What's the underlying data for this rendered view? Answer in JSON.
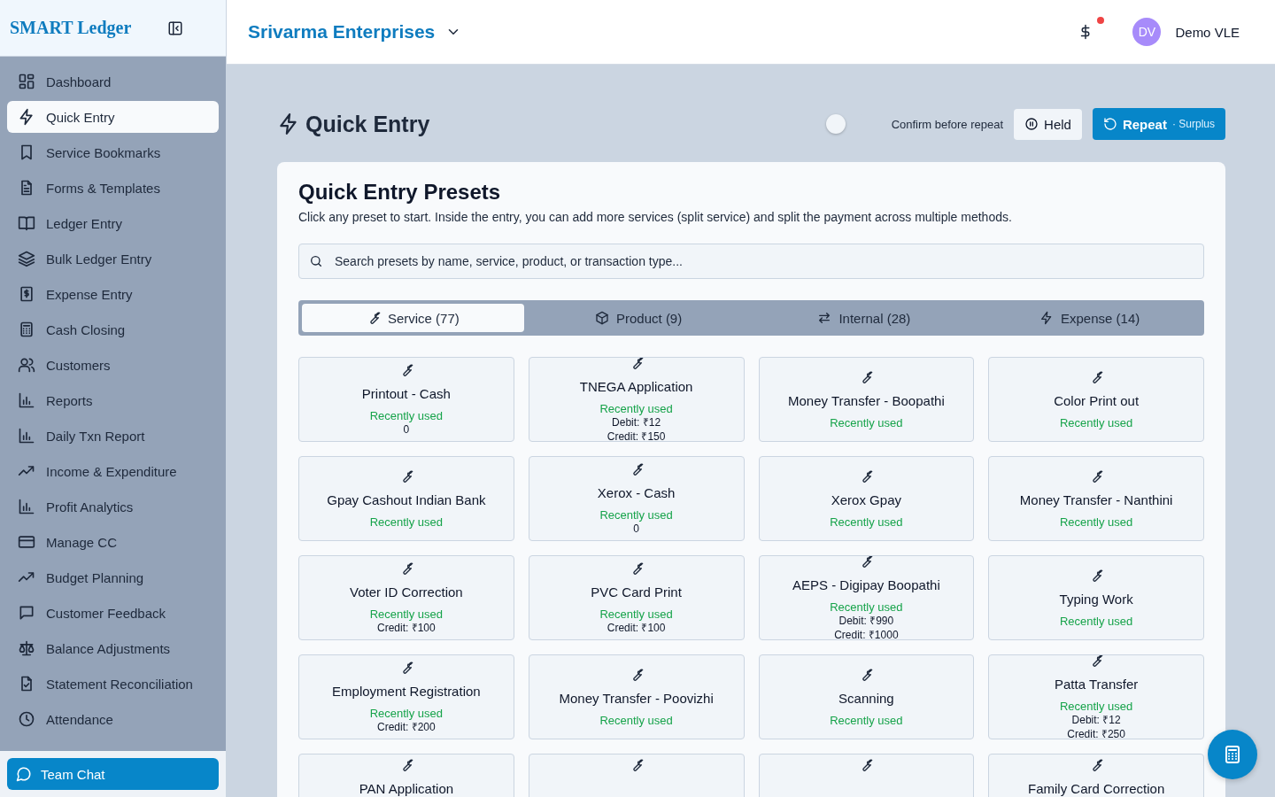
{
  "sidebar": {
    "logo": "SMART Ledger",
    "items": [
      {
        "label": "Dashboard",
        "selected": false
      },
      {
        "label": "Quick Entry",
        "selected": true
      },
      {
        "label": "Service Bookmarks",
        "selected": false
      },
      {
        "label": "Forms & Templates",
        "selected": false
      },
      {
        "label": "Ledger Entry",
        "selected": false
      },
      {
        "label": "Bulk Ledger Entry",
        "selected": false
      },
      {
        "label": "Expense Entry",
        "selected": false
      },
      {
        "label": "Cash Closing",
        "selected": false
      },
      {
        "label": "Customers",
        "selected": false
      },
      {
        "label": "Reports",
        "selected": false
      },
      {
        "label": "Daily Txn Report",
        "selected": false
      },
      {
        "label": "Income & Expenditure",
        "selected": false
      },
      {
        "label": "Profit Analytics",
        "selected": false
      },
      {
        "label": "Manage CC",
        "selected": false
      },
      {
        "label": "Budget Planning",
        "selected": false
      },
      {
        "label": "Customer Feedback",
        "selected": false
      },
      {
        "label": "Balance Adjustments",
        "selected": false
      },
      {
        "label": "Statement Reconciliation",
        "selected": false
      },
      {
        "label": "Attendance",
        "selected": false
      }
    ],
    "chat_button": "Team Chat"
  },
  "topbar": {
    "business": "Srivarma Enterprises",
    "notification": true,
    "avatar": "DV",
    "user": "Demo VLE"
  },
  "page": {
    "title": "Quick Entry",
    "confirm_toggle": {
      "label": "Confirm before repeat",
      "on": false
    },
    "held_button": "Held",
    "repeat_button": {
      "label": "Repeat",
      "note": "· Surplus"
    }
  },
  "presets": {
    "title": "Quick Entry Presets",
    "description": "Click any preset to start. Inside the entry, you can add more services (split service) and split the payment across multiple methods.",
    "search": {
      "placeholder": "Search presets by name, service, product, or transaction type..."
    },
    "tabs": [
      {
        "label": "Service (77)",
        "selected": true
      },
      {
        "label": "Product (9)",
        "selected": false
      },
      {
        "label": "Internal (28)",
        "selected": false
      },
      {
        "label": "Expense (14)",
        "selected": false
      }
    ],
    "cards": [
      {
        "title": "Printout - Cash",
        "badge": "Recently used",
        "details": [
          "0"
        ],
        "kind": "service"
      },
      {
        "title": "TNEGA Application",
        "badge": "Recently used",
        "details": [
          "Debit: ₹12",
          "Credit: ₹150"
        ],
        "kind": "service"
      },
      {
        "title": "Money Transfer - Boopathi",
        "badge": "Recently used",
        "kind": "service"
      },
      {
        "title": "Color Print out",
        "badge": "Recently used",
        "kind": "service"
      },
      {
        "title": "Gpay Cashout Indian Bank",
        "badge": "Recently used",
        "kind": "service"
      },
      {
        "title": "Xerox - Cash",
        "badge": "Recently used",
        "details": [
          "0"
        ],
        "kind": "service"
      },
      {
        "title": "Xerox Gpay",
        "badge": "Recently used",
        "kind": "service"
      },
      {
        "title": "Money Transfer - Nanthini",
        "badge": "Recently used",
        "kind": "service"
      },
      {
        "title": "Voter ID Correction",
        "badge": "Recently used",
        "details": [
          "Credit: ₹100"
        ],
        "kind": "service"
      },
      {
        "title": "PVC Card Print",
        "badge": "Recently used",
        "details": [
          "Credit: ₹100"
        ],
        "kind": "service"
      },
      {
        "title": "AEPS - Digipay Boopathi",
        "badge": "Recently used",
        "details": [
          "Debit: ₹990",
          "Credit: ₹1000"
        ],
        "kind": "service"
      },
      {
        "title": "Typing Work",
        "badge": "Recently used",
        "kind": "service"
      },
      {
        "title": "Employment Registration",
        "badge": "Recently used",
        "details": [
          "Credit: ₹200"
        ],
        "kind": "service"
      },
      {
        "title": "Money Transfer - Poovizhi",
        "badge": "Recently used",
        "kind": "service"
      },
      {
        "title": "Scanning",
        "badge": "Recently used",
        "kind": "service"
      },
      {
        "title": "Patta Transfer",
        "badge": "Recently used",
        "details": [
          "Debit: ₹12",
          "Credit: ₹250"
        ],
        "kind": "service"
      },
      {
        "title": "PAN Application",
        "kind": "service"
      },
      {
        "kind": "service"
      },
      {
        "kind": "service"
      },
      {
        "title": "Family Card Correction",
        "kind": "service"
      }
    ]
  }
}
